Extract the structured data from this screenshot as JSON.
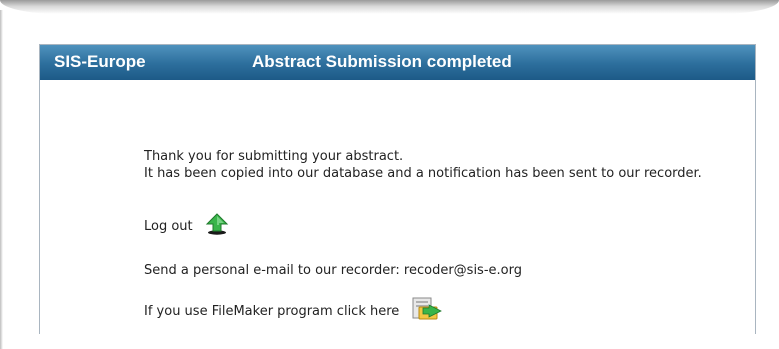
{
  "header": {
    "brand": "SIS-Europe",
    "title": "Abstract Submission completed"
  },
  "message": {
    "line1": "Thank you for submitting your abstract.",
    "line2": "It has been copied into our database and a notification has been sent to our recorder."
  },
  "logout": {
    "label": "Log out",
    "icon": "upload-arrow-icon"
  },
  "email": {
    "text": "Send a personal e-mail to our recorder: recoder@sis-e.org"
  },
  "filemaker": {
    "text": "If you use FileMaker program click here",
    "icon": "filemaker-export-icon"
  },
  "colors": {
    "header_top": "#4f92bd",
    "header_bottom": "#1d5a87",
    "arrow_green": "#39b54a"
  }
}
